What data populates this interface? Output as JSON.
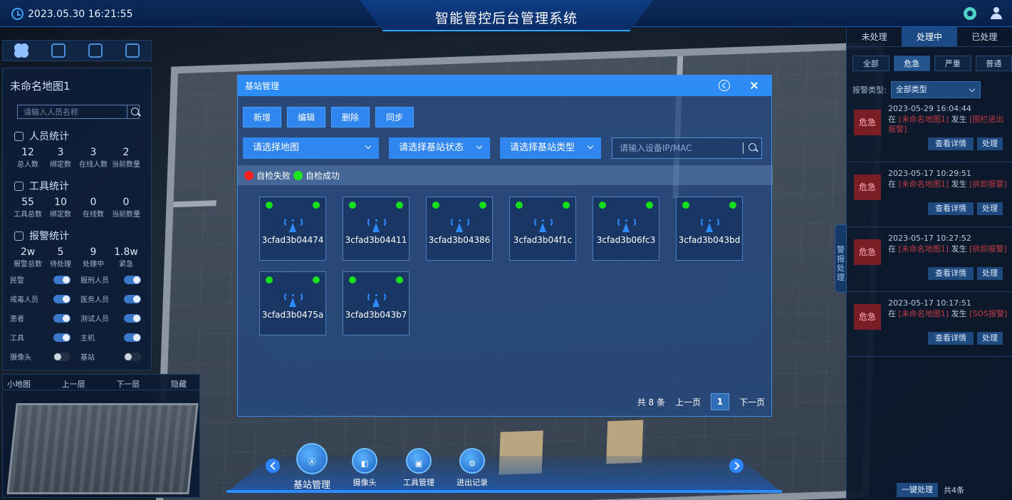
{
  "header": {
    "datetime": "2023.05.30 16:21:55",
    "title": "智能管控后台管理系统"
  },
  "left_panel": {
    "map_name": "未命名地图1",
    "search_placeholder": "请输入人员名称",
    "person_stats": {
      "title": "人员统计",
      "items": [
        {
          "value": "12",
          "label": "总人数"
        },
        {
          "value": "3",
          "label": "绑定数"
        },
        {
          "value": "3",
          "label": "在线人数"
        },
        {
          "value": "2",
          "label": "当前数量"
        }
      ]
    },
    "tool_stats": {
      "title": "工具统计",
      "items": [
        {
          "value": "55",
          "label": "工具总数"
        },
        {
          "value": "10",
          "label": "绑定数"
        },
        {
          "value": "0",
          "label": "在线数"
        },
        {
          "value": "0",
          "label": "当前数量"
        }
      ]
    },
    "alarm_stats": {
      "title": "报警统计",
      "items": [
        {
          "value": "2w",
          "label": "报警总数"
        },
        {
          "value": "5",
          "label": "待处理"
        },
        {
          "value": "9",
          "label": "处理中"
        },
        {
          "value": "1.8w",
          "label": "紧急"
        }
      ]
    },
    "toggles": [
      {
        "label": "民警",
        "on": true
      },
      {
        "label": "服刑人员",
        "on": true
      },
      {
        "label": "戒毒人员",
        "on": true
      },
      {
        "label": "医务人员",
        "on": true
      },
      {
        "label": "患者",
        "on": true
      },
      {
        "label": "测试人员",
        "on": true
      },
      {
        "label": "工具",
        "on": true
      },
      {
        "label": "主机",
        "on": true
      },
      {
        "label": "摄像头",
        "on": false
      },
      {
        "label": "基站",
        "on": false
      }
    ]
  },
  "minimap": {
    "label": "小地图",
    "up": "上一层",
    "down": "下一层",
    "hide": "隐藏"
  },
  "right_panel": {
    "tabs": [
      "未处理",
      "处理中",
      "已处理"
    ],
    "levels": [
      "全部",
      "危急",
      "严重",
      "普通"
    ],
    "filter_label": "报警类型:",
    "filter_value": "全部类型",
    "alarms": [
      {
        "level": "危急",
        "time": "2023-05-29 16:04:44",
        "prefix": "在",
        "map": "[未命名地图1]",
        "mid": "发生",
        "type": "[围栏进出报警]"
      },
      {
        "level": "危急",
        "time": "2023-05-17 10:29:51",
        "prefix": "在",
        "map": "[未命名地图1]",
        "mid": "发生",
        "type": "[拆卸报警]"
      },
      {
        "level": "危急",
        "time": "2023-05-17 10:27:52",
        "prefix": "在",
        "map": "[未命名地图1]",
        "mid": "发生",
        "type": "[拆卸报警]"
      },
      {
        "level": "危急",
        "time": "2023-05-17 10:17:51",
        "prefix": "在",
        "map": "[未命名地图1]",
        "mid": "发生",
        "type": "[SOS报警]"
      }
    ],
    "detail_label": "查看详情",
    "handle_label": "处理",
    "side_tab": "警报处理",
    "one_click": "一键处理",
    "total": "共4条"
  },
  "dock": {
    "items": [
      "基站管理",
      "摄像头",
      "工具管理",
      "进出记录"
    ]
  },
  "modal": {
    "title": "基站管理",
    "actions": [
      "新增",
      "编辑",
      "删除",
      "同步"
    ],
    "filters": [
      "请选择地图",
      "请选择基站状态",
      "请选择基站类型"
    ],
    "search_placeholder": "请输入设备IP/MAC",
    "legend": {
      "fail": "自检失败",
      "success": "自检成功"
    },
    "stations": [
      "3cfad3b04474",
      "3cfad3b04411",
      "3cfad3b04386",
      "3cfad3b04f1c",
      "3cfad3b06fc3",
      "3cfad3b043bd",
      "3cfad3b0475a",
      "3cfad3b043b7"
    ],
    "pager": {
      "total": "共 8 条",
      "prev": "上一页",
      "page": "1",
      "next": "下一页"
    }
  },
  "colors": {
    "accent": "#2e8bff",
    "success": "#1ee61e",
    "fail": "#ff1d1d",
    "danger_badge": "#7a1e26"
  }
}
